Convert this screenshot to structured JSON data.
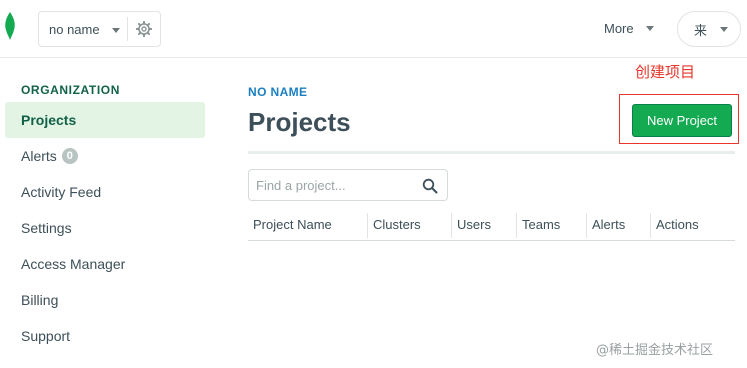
{
  "topbar": {
    "org_name": "no name",
    "more_label": "More",
    "user_name": "来"
  },
  "sidebar": {
    "heading": "ORGANIZATION",
    "items": [
      {
        "label": "Projects",
        "active": true
      },
      {
        "label": "Alerts",
        "badge": "0"
      },
      {
        "label": "Activity Feed"
      },
      {
        "label": "Settings"
      },
      {
        "label": "Access Manager"
      },
      {
        "label": "Billing"
      },
      {
        "label": "Support"
      }
    ]
  },
  "main": {
    "breadcrumb": "NO NAME",
    "title": "Projects",
    "new_project_label": "New Project",
    "annotation": "创建项目",
    "search_placeholder": "Find a project...",
    "columns": [
      "Project Name",
      "Clusters",
      "Users",
      "Teams",
      "Alerts",
      "Actions"
    ]
  },
  "watermark": "@稀土掘金技术社区",
  "colors": {
    "brand_green": "#13aa52",
    "annotation_red": "#e8362b",
    "link_blue": "#1a7fc1"
  },
  "icons": [
    "mongodb-leaf-icon",
    "gear-icon",
    "chevron-down-icon",
    "search-icon"
  ]
}
